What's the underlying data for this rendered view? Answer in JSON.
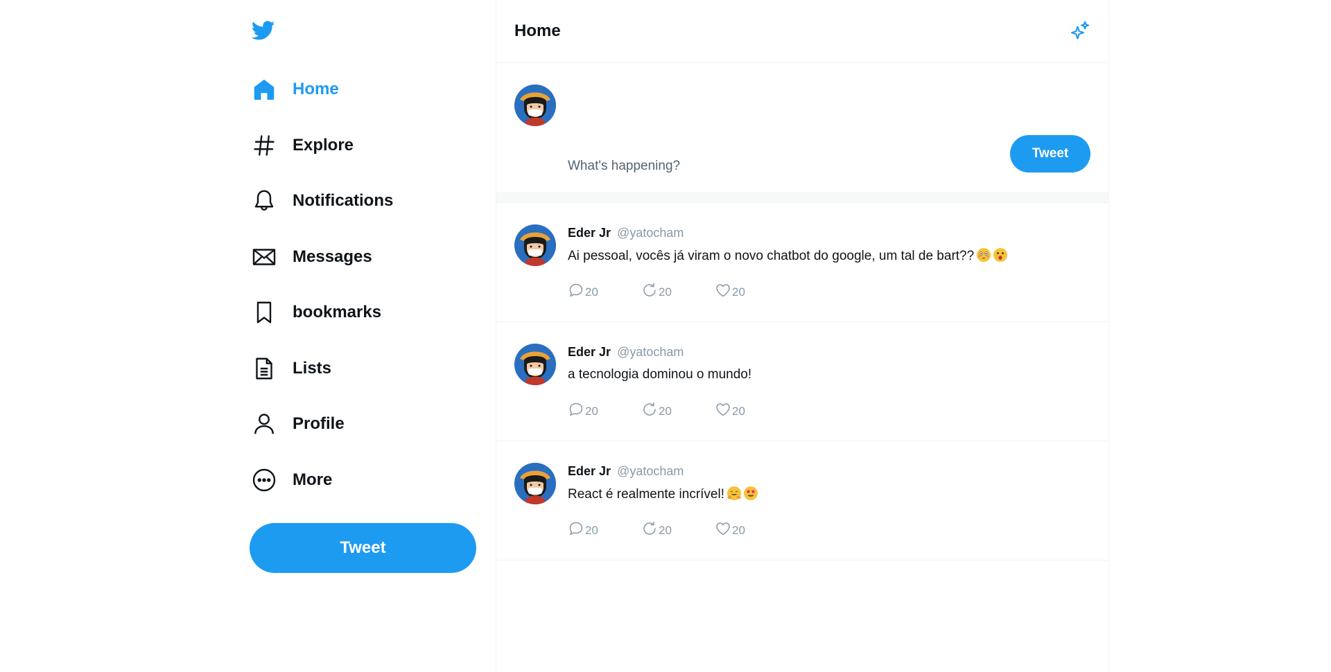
{
  "colors": {
    "accent": "#1d9bf0",
    "text": "#0f1419",
    "muted": "#8899a6",
    "border": "#eff3f4"
  },
  "sidebar": {
    "logo_icon": "twitter-bird-icon",
    "items": [
      {
        "label": "Home",
        "icon": "home-icon",
        "active": true
      },
      {
        "label": "Explore",
        "icon": "hashtag-icon"
      },
      {
        "label": "Notifications",
        "icon": "bell-icon"
      },
      {
        "label": "Messages",
        "icon": "envelope-icon"
      },
      {
        "label": "bookmarks",
        "icon": "bookmark-icon"
      },
      {
        "label": "Lists",
        "icon": "list-document-icon"
      },
      {
        "label": "Profile",
        "icon": "user-icon"
      },
      {
        "label": "More",
        "icon": "more-circle-icon"
      }
    ],
    "tweet_button": "Tweet"
  },
  "header": {
    "title": "Home",
    "icon": "sparkle-icon"
  },
  "composer": {
    "placeholder": "What's happening?",
    "button": "Tweet"
  },
  "tweets": [
    {
      "author": "Eder Jr",
      "handle": "@yatocham",
      "text": "Ai pessoal, vocês já viram o novo chatbot do google, um tal de bart??",
      "emojis": [
        "flushed-face",
        "astonished-face"
      ],
      "replies": "20",
      "retweets": "20",
      "likes": "20"
    },
    {
      "author": "Eder Jr",
      "handle": "@yatocham",
      "text": "a tecnologia dominou o mundo!",
      "emojis": [],
      "replies": "20",
      "retweets": "20",
      "likes": "20"
    },
    {
      "author": "Eder Jr",
      "handle": "@yatocham",
      "text": "React é realmente incrível!",
      "emojis": [
        "hugging-face",
        "star-struck-face"
      ],
      "replies": "20",
      "retweets": "20",
      "likes": "20"
    }
  ]
}
